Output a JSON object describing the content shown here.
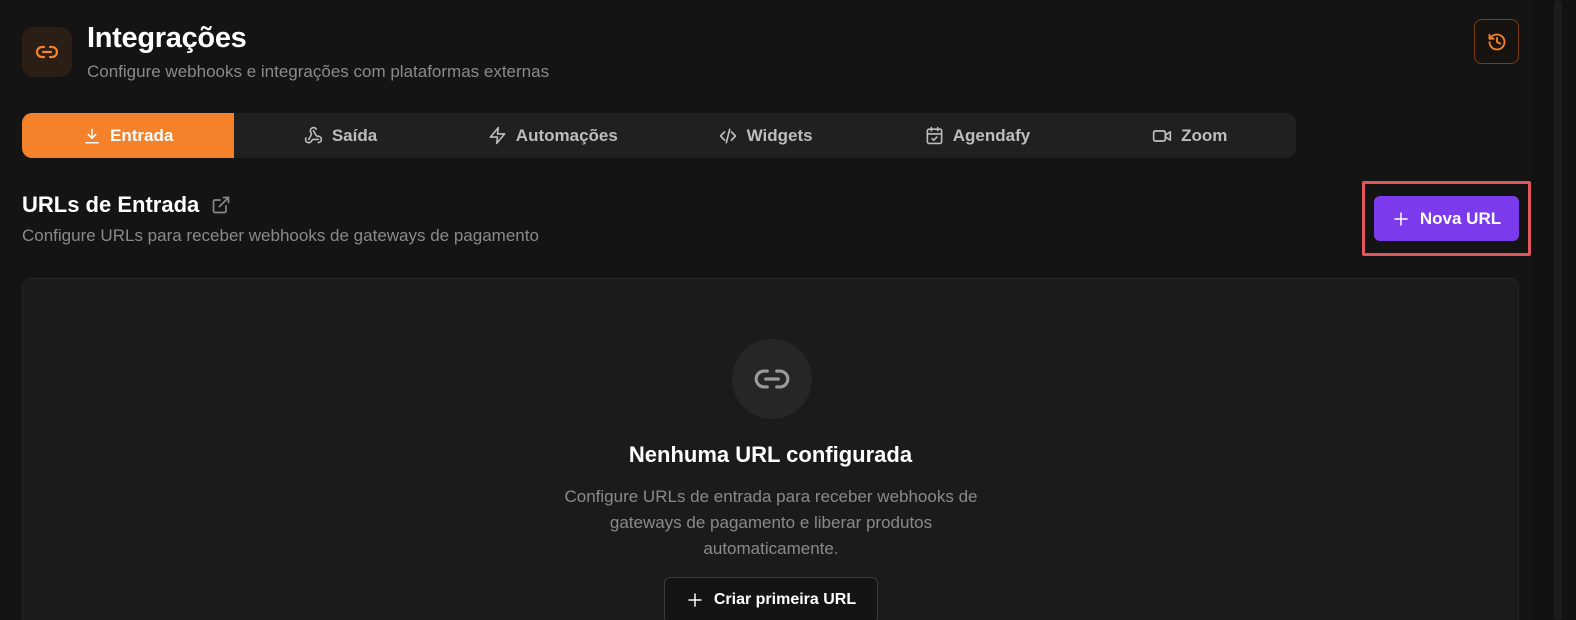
{
  "header": {
    "title": "Integrações",
    "subtitle": "Configure webhooks e integrações com plataformas externas",
    "app_icon": "link-icon",
    "history_icon": "history-icon"
  },
  "tabs": [
    {
      "label": "Entrada",
      "icon": "download-icon",
      "active": true
    },
    {
      "label": "Saída",
      "icon": "webhook-icon",
      "active": false
    },
    {
      "label": "Automações",
      "icon": "zap-icon",
      "active": false
    },
    {
      "label": "Widgets",
      "icon": "code-icon",
      "active": false
    },
    {
      "label": "Agendafy",
      "icon": "calendar-check-icon",
      "active": false
    },
    {
      "label": "Zoom",
      "icon": "video-icon",
      "active": false
    }
  ],
  "section": {
    "title": "URLs de Entrada",
    "subtitle": "Configure URLs para receber webhooks de gateways de pagamento",
    "new_button_label": "Nova URL"
  },
  "empty_state": {
    "title": "Nenhuma URL configurada",
    "description": "Configure URLs de entrada para receber webhooks de gateways de pagamento e liberar produtos automaticamente.",
    "button_label": "Criar primeira URL"
  },
  "colors": {
    "accent_orange": "#f5822a",
    "primary_purple": "#7c3aed",
    "highlight_red": "#e0585b",
    "background": "#141414"
  }
}
